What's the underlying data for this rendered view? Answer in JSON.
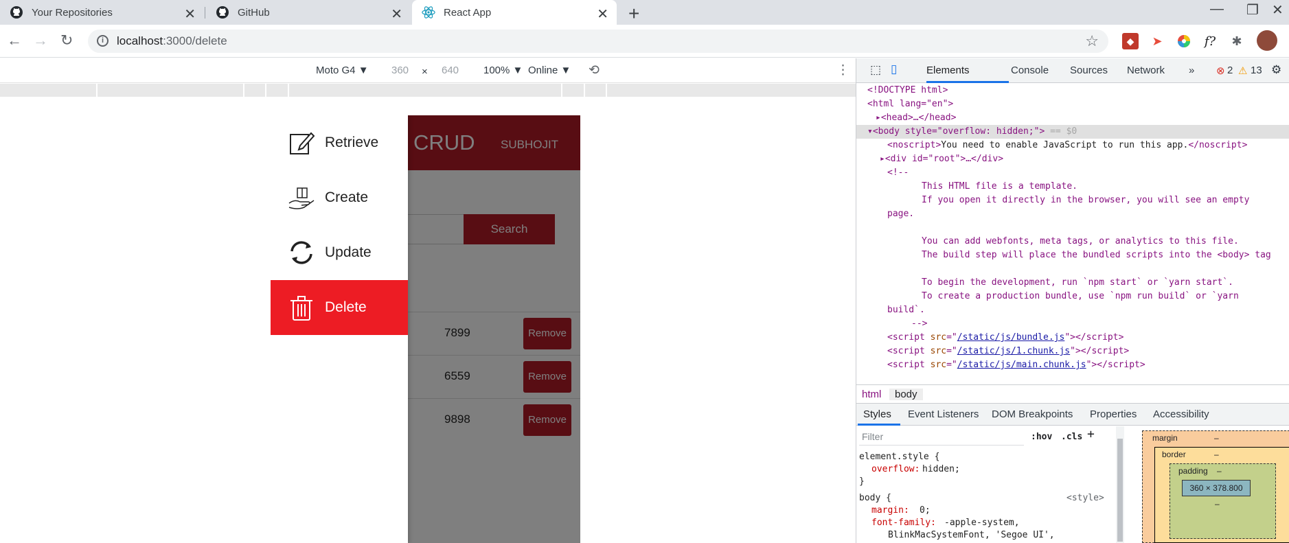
{
  "browser": {
    "tabs": [
      {
        "title": "Your Repositories",
        "icon": "github-icon"
      },
      {
        "title": "GitHub",
        "icon": "github-icon"
      },
      {
        "title": "React App",
        "icon": "react-icon"
      }
    ],
    "url_host": "localhost",
    "url_path": ":3000/delete"
  },
  "device_toolbar": {
    "device": "Moto G4 ▼",
    "width": "360",
    "times": "×",
    "height": "640",
    "zoom": "100% ▼",
    "throttle": "Online ▼"
  },
  "app": {
    "brand": "CRUD",
    "user": "SUBHOJIT",
    "search_label": "Search",
    "rows": [
      {
        "value": "7899",
        "action": "Remove"
      },
      {
        "value": "6559",
        "action": "Remove"
      },
      {
        "value": "9898",
        "action": "Remove"
      }
    ],
    "drawer": [
      {
        "label": "Retrieve",
        "icon": "edit-icon"
      },
      {
        "label": "Create",
        "icon": "gift-hand-icon"
      },
      {
        "label": "Update",
        "icon": "refresh-icon"
      },
      {
        "label": "Delete",
        "icon": "trash-icon",
        "selected": true
      }
    ],
    "colors": {
      "primary": "#b11a27",
      "drawer_selected": "#ed1c24"
    }
  },
  "devtools": {
    "tabs": [
      "Elements",
      "Console",
      "Sources",
      "Network",
      "»"
    ],
    "errors": "2",
    "warnings": "13",
    "dom": {
      "doctype": "<!DOCTYPE html>",
      "html_open": "<html lang=\"en\">",
      "head": "<head>…</head>",
      "body_open": "<body style=\"overflow: hidden;\">",
      "body_eq": "== $0",
      "noscript_text": "You need to enable JavaScript to run this app.",
      "div_root": "<div id=\"root\">…</div>",
      "comment_open": "<!--",
      "comment_1": "This HTML file is a template.",
      "comment_2": "If you open it directly in the browser, you will see an empty",
      "comment_2b": "page.",
      "comment_3": "You can add webfonts, meta tags, or analytics to this file.",
      "comment_4": "The build step will place the bundled scripts into the <body> tag",
      "comment_5": "To begin the development, run `npm start` or `yarn start`.",
      "comment_6": "To create a production bundle, use `npm run build` or `yarn",
      "comment_6b": "build`.",
      "comment_close": "-->",
      "scripts": [
        "/static/js/bundle.js",
        "/static/js/1.chunk.js",
        "/static/js/main.chunk.js"
      ]
    },
    "breadcrumbs": [
      "html",
      "body"
    ],
    "sub_tabs": [
      "Styles",
      "Event Listeners",
      "DOM Breakpoints",
      "Properties",
      "Accessibility"
    ],
    "filter_placeholder": "Filter",
    "hov": ":hov",
    "cls": ".cls",
    "styles": {
      "element_style": "element.style {",
      "overflow_prop": "overflow:",
      "overflow_val": "hidden;",
      "close": "}",
      "body_rule": "body {",
      "body_source": "<style>",
      "margin_prop": "margin:",
      "margin_val": "0;",
      "font_prop": "font-family:",
      "font_val": "-apple-system,",
      "font_val2": "BlinkMacSystemFont, 'Segoe UI',"
    },
    "box_model": {
      "margin": "margin",
      "border": "border",
      "padding": "padding",
      "dash": "–",
      "content": "360 × 378.800"
    }
  }
}
